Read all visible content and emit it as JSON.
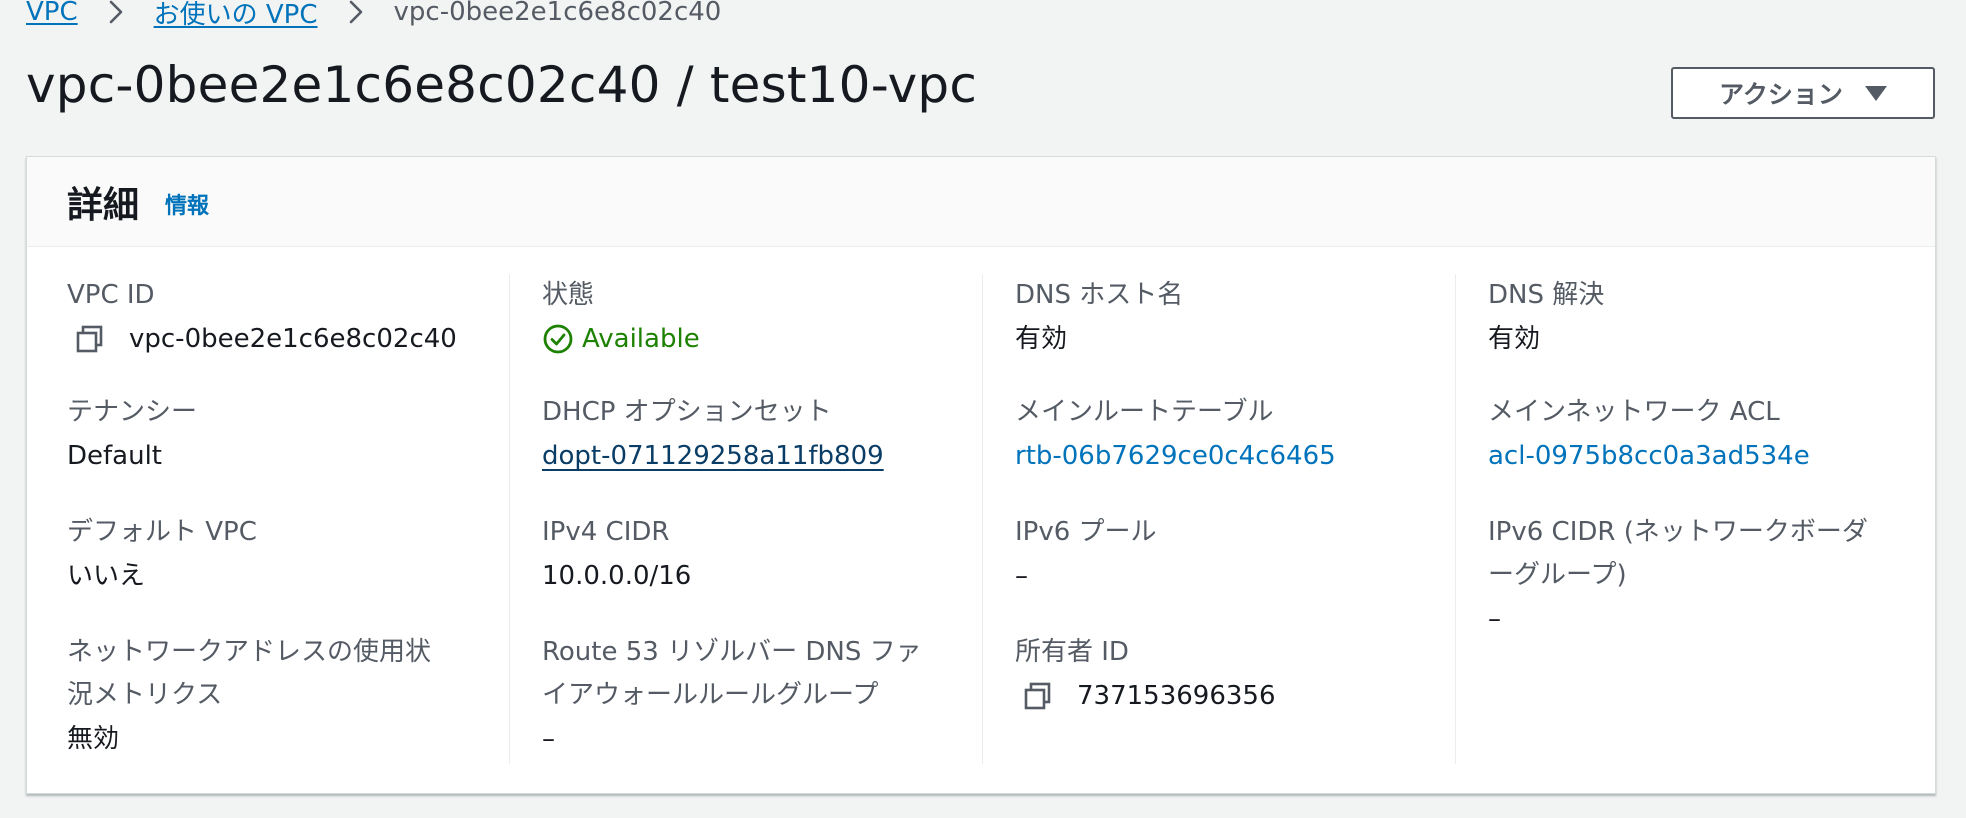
{
  "breadcrumb": {
    "items": [
      "VPC",
      "お使いの VPC"
    ],
    "current": "vpc-0bee2e1c6e8c02c40"
  },
  "page": {
    "title": "vpc-0bee2e1c6e8c02c40 / test10-vpc",
    "action_button": "アクション"
  },
  "details": {
    "title": "詳細",
    "info_link": "情報",
    "col1": {
      "vpc_id_label": "VPC ID",
      "vpc_id_value": "vpc-0bee2e1c6e8c02c40",
      "tenancy_label": "テナンシー",
      "tenancy_value": "Default",
      "default_vpc_label": "デフォルト VPC",
      "default_vpc_value": "いいえ",
      "nau_label_line1": "ネットワークアドレスの使用状",
      "nau_label_line2": "況メトリクス",
      "nau_value": "無効"
    },
    "col2": {
      "state_label": "状態",
      "state_value": "Available",
      "dhcp_label": "DHCP オプションセット",
      "dhcp_value": "dopt-071129258a11fb809",
      "ipv4_label": "IPv4 CIDR",
      "ipv4_value": "10.0.0.0/16",
      "r53_label_line1": "Route 53 リゾルバー DNS ファ",
      "r53_label_line2": "イアウォールルールグループ",
      "r53_value": "–"
    },
    "col3": {
      "dns_hostname_label": "DNS ホスト名",
      "dns_hostname_value": "有効",
      "main_rt_label": "メインルートテーブル",
      "main_rt_value": "rtb-06b7629ce0c4c6465",
      "ipv6_pool_label": "IPv6 プール",
      "ipv6_pool_value": "–",
      "owner_label": "所有者 ID",
      "owner_value": "737153696356"
    },
    "col4": {
      "dns_resolution_label": "DNS 解決",
      "dns_resolution_value": "有効",
      "main_acl_label": "メインネットワーク ACL",
      "main_acl_value": "acl-0975b8cc0a3ad534e",
      "ipv6_cidr_label_line1": "IPv6 CIDR (ネットワークボーダ",
      "ipv6_cidr_label_line2": "ーグループ)",
      "ipv6_cidr_value": "–"
    }
  },
  "icons": {
    "copy": "copy-icon",
    "status_ok": "check-circle-icon",
    "breadcrumb_separator": "chevron-right-icon",
    "dropdown": "caret-down-icon"
  },
  "colors": {
    "link": "#0073bb",
    "success": "#1d8102",
    "background": "#f2f3f3"
  }
}
